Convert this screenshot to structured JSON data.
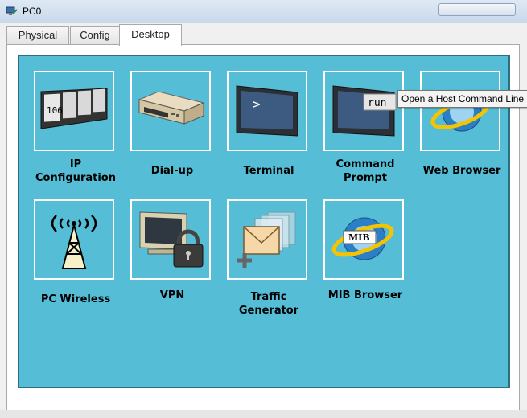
{
  "window": {
    "title": "PC0"
  },
  "tabs": [
    {
      "label": "Physical"
    },
    {
      "label": "Config"
    },
    {
      "label": "Desktop"
    }
  ],
  "active_tab": "Desktop",
  "apps": [
    {
      "label": "IP\nConfiguration",
      "icon": "ip-configuration-icon",
      "icon_text": "106"
    },
    {
      "label": "Dial-up",
      "icon": "modem-icon"
    },
    {
      "label": "Terminal",
      "icon": "terminal-icon",
      "icon_text": ">"
    },
    {
      "label": "Command\nPrompt",
      "icon": "command-prompt-icon",
      "icon_text": "run"
    },
    {
      "label": "Web Browser",
      "icon": "web-browser-icon"
    },
    {
      "label": "PC Wireless",
      "icon": "wireless-tower-icon"
    },
    {
      "label": "VPN",
      "icon": "vpn-lock-icon"
    },
    {
      "label": "Traffic\nGenerator",
      "icon": "traffic-generator-icon"
    },
    {
      "label": "MIB Browser",
      "icon": "mib-browser-icon",
      "icon_text": "MIB"
    }
  ],
  "tooltip": {
    "text": "Open a Host Command Line"
  },
  "colors": {
    "desktop_bg": "#55bed6",
    "desktop_border": "#2d6f80",
    "tile_border": "#ffffff"
  }
}
